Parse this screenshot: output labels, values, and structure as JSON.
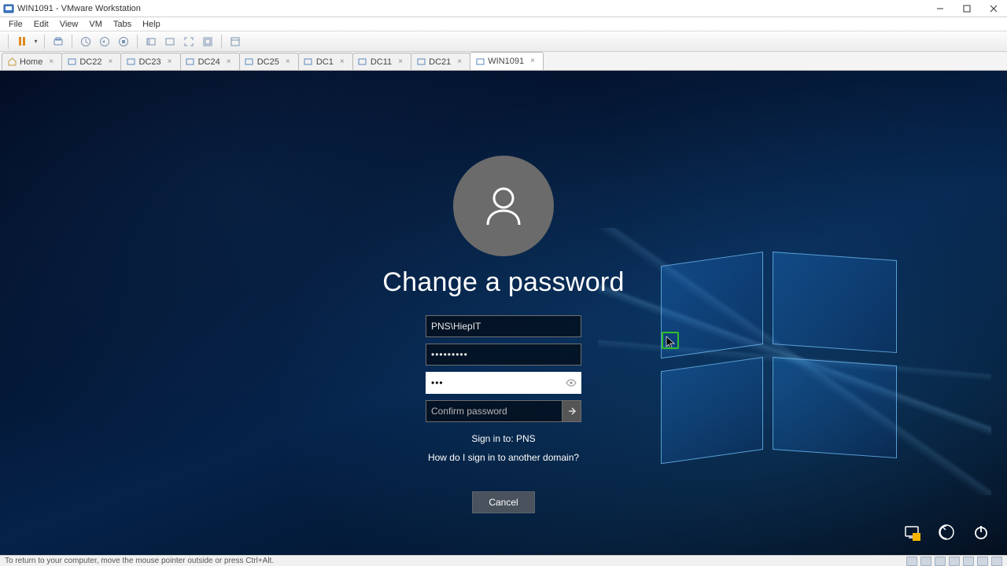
{
  "titlebar": {
    "title": "WIN1091 - VMware Workstation"
  },
  "menubar": [
    "File",
    "Edit",
    "View",
    "VM",
    "Tabs",
    "Help"
  ],
  "tabs": [
    {
      "label": "Home",
      "icon": "home",
      "active": false
    },
    {
      "label": "DC22",
      "icon": "vm",
      "active": false
    },
    {
      "label": "DC23",
      "icon": "vm",
      "active": false
    },
    {
      "label": "DC24",
      "icon": "vm",
      "active": false
    },
    {
      "label": "DC25",
      "icon": "vm",
      "active": false
    },
    {
      "label": "DC1",
      "icon": "vm",
      "active": false
    },
    {
      "label": "DC11",
      "icon": "vm",
      "active": false
    },
    {
      "label": "DC21",
      "icon": "vm",
      "active": false
    },
    {
      "label": "WIN1091",
      "icon": "vm",
      "active": true
    }
  ],
  "cred": {
    "heading": "Change a password",
    "username": "PNS\\HiepIT",
    "old_password": "•••••••••",
    "new_password": "•••",
    "confirm_placeholder": "Confirm password",
    "signin_to": "Sign in to: PNS",
    "other_domain": "How do I sign in to another domain?",
    "cancel": "Cancel"
  },
  "statusbar": {
    "hint": "To return to your computer, move the mouse pointer outside or press Ctrl+Alt."
  }
}
